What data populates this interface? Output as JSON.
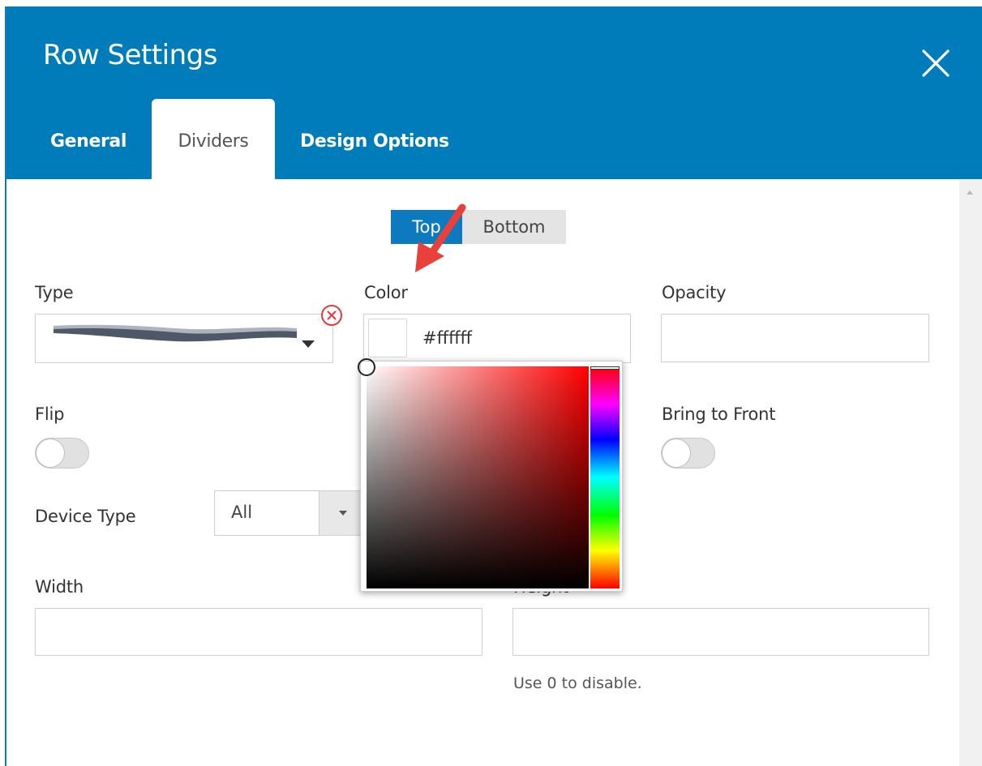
{
  "dialog": {
    "title": "Row Settings",
    "tabs": [
      {
        "label": "General"
      },
      {
        "label": "Dividers"
      },
      {
        "label": "Design Options"
      }
    ]
  },
  "position_toggle": {
    "top": "Top",
    "bottom": "Bottom"
  },
  "fields": {
    "type_label": "Type",
    "color_label": "Color",
    "color_value": "#ffffff",
    "opacity_label": "Opacity",
    "opacity_value": "",
    "flip_label": "Flip",
    "bring_to_front_label": "Bring to Front",
    "device_type_label": "Device Type",
    "device_type_value": "All",
    "width_label": "Width",
    "width_value": "",
    "height_label": "Height",
    "height_value": "",
    "height_help": "Use 0 to disable."
  },
  "toggles": {
    "flip_on": false,
    "bring_to_front_on": false
  },
  "colors": {
    "accent": "#007cba",
    "selected_hue": "#ff0000",
    "annotation_arrow": "#e8403a"
  },
  "icons": {
    "close": "close-icon",
    "clear": "clear-circle-x-icon",
    "caret": "caret-down-icon"
  }
}
